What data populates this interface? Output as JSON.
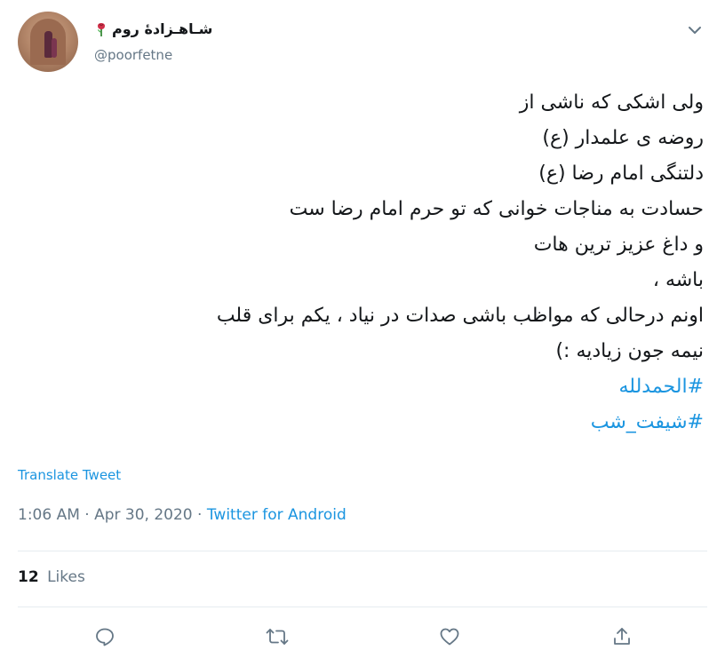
{
  "user": {
    "display_name": "شـاهـزادهٔ روم",
    "username": "@poorfetne"
  },
  "tweet": {
    "lines": [
      "ولی اشکی که ناشی از",
      "روضه ی علمدار (ع)",
      "دلتنگی امام رضا (ع)",
      "حسادت به مناجات خوانی که تو حرم امام رضا ست",
      "و داغ عزیز ترین هات",
      "باشه ،",
      "اونم درحالی که مواظب باشی صدات در نیاد ، یکم برای قلب",
      "نیمه جون زیادیه :)"
    ],
    "hashtags": [
      "#الحمدلله",
      "#شیفت_شب"
    ]
  },
  "translate_label": "Translate Tweet",
  "meta": {
    "time": "1:06 AM",
    "date": "Apr 30, 2020",
    "separator": "·",
    "client": "Twitter for Android"
  },
  "stats": {
    "likes_count": "12",
    "likes_label": "Likes"
  },
  "icons": {
    "caret": "chevron-down-icon",
    "reply": "reply-icon",
    "retweet": "retweet-icon",
    "like": "heart-icon",
    "share": "share-icon",
    "emoji": "rose-emoji-icon"
  },
  "colors": {
    "link": "#1b95e0",
    "secondary": "#657786",
    "text": "#14171a",
    "divider": "#e6ecf0"
  }
}
